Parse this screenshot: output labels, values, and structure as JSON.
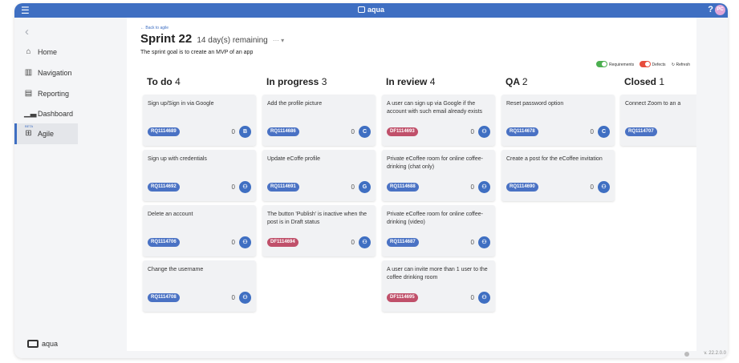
{
  "app": {
    "name": "aqua",
    "help": "?",
    "user_initials": "PC",
    "menu_icon": "hamburger-icon",
    "version": "v. 22.2.0.0"
  },
  "sidebar": {
    "back_icon": "chevron-left-icon",
    "items": [
      {
        "label": "Home",
        "icon": "home-icon"
      },
      {
        "label": "Navigation",
        "icon": "map-icon"
      },
      {
        "label": "Reporting",
        "icon": "document-icon"
      },
      {
        "label": "Dashboard",
        "icon": "bar-chart-icon"
      },
      {
        "label": "Agile",
        "icon": "board-icon",
        "badge": "BETA",
        "active": true
      }
    ],
    "footer_logo": "aqua"
  },
  "header": {
    "back_link": "← Back to agile",
    "sprint_name": "Sprint 22",
    "remaining": "14 day(s) remaining",
    "more": "··· ▾",
    "goal": "The sprint goal is to create an MVP of an app"
  },
  "toolbar": {
    "requirements_label": "Requirements",
    "defects_label": "Defects",
    "refresh_label": "Refresh",
    "requirements_color": "#4caf50",
    "defects_color": "#e74c3c"
  },
  "colors": {
    "requirement_tag": "#4a72c4",
    "defect_tag": "#c0506a",
    "avatar": "#3f6fc2"
  },
  "columns": [
    {
      "title": "To do",
      "count": "4",
      "cards": [
        {
          "title": "Sign up/Sign in via Google",
          "id": "RQ1114689",
          "type": "req",
          "count": "0",
          "assignee": "B"
        },
        {
          "title": "Sign up with credentials",
          "id": "RQ1114692",
          "type": "req",
          "count": "0",
          "assignee": ""
        },
        {
          "title": "Delete an account",
          "id": "RQ1114706",
          "type": "req",
          "count": "0",
          "assignee": ""
        },
        {
          "title": "Change the username",
          "id": "RQ1114708",
          "type": "req",
          "count": "0",
          "assignee": ""
        }
      ]
    },
    {
      "title": "In progress",
      "count": "3",
      "cards": [
        {
          "title": "Add the profile picture",
          "id": "RQ1114686",
          "type": "req",
          "count": "0",
          "assignee": "C"
        },
        {
          "title": "Update eCoffe profile",
          "id": "RQ1114691",
          "type": "req",
          "count": "0",
          "assignee": "G"
        },
        {
          "title": "The button 'Publish' is inactive when the post is in Draft status",
          "id": "DF1114694",
          "type": "def",
          "count": "0",
          "assignee": ""
        }
      ]
    },
    {
      "title": "In review",
      "count": "4",
      "cards": [
        {
          "title": "A user can sign up via Google if the account with such email already exists",
          "id": "DF1114693",
          "type": "def",
          "count": "0",
          "assignee": ""
        },
        {
          "title": "Private eCoffee room for online coffee-drinking (chat only)",
          "id": "RQ1114688",
          "type": "req",
          "count": "0",
          "assignee": ""
        },
        {
          "title": "Private eCoffee room for online coffee-drinking (video)",
          "id": "RQ1114687",
          "type": "req",
          "count": "0",
          "assignee": ""
        },
        {
          "title": "A user can invite more than 1 user to the coffee drinking room",
          "id": "DF1114695",
          "type": "def",
          "count": "0",
          "assignee": ""
        }
      ]
    },
    {
      "title": "QA",
      "count": "2",
      "cards": [
        {
          "title": "Reset password option",
          "id": "RQ1114678",
          "type": "req",
          "count": "0",
          "assignee": "C"
        },
        {
          "title": "Create a post for the eCoffee invitation",
          "id": "RQ1114690",
          "type": "req",
          "count": "0",
          "assignee": ""
        }
      ]
    },
    {
      "title": "Closed",
      "count": "1",
      "cards": [
        {
          "title": "Connect Zoom to an a",
          "id": "RQ1114707",
          "type": "req",
          "count": "",
          "assignee": ""
        }
      ]
    }
  ]
}
